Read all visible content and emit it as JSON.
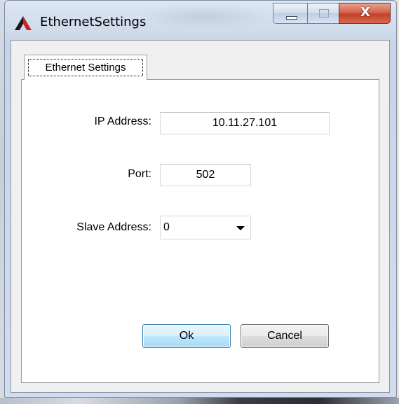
{
  "window": {
    "title": "EthernetSettings",
    "icon": "app-logo-icon",
    "buttons": {
      "minimize_icon": "minimize-icon",
      "maximize_icon": "maximize-icon",
      "close_icon": "close-icon",
      "close_glyph": "X"
    }
  },
  "tabs": [
    {
      "label": "Ethernet Settings",
      "selected": true
    }
  ],
  "form": {
    "ip_label": "IP Address:",
    "ip_value": "10.11.27.101",
    "port_label": "Port:",
    "port_value": "502",
    "slave_label": "Slave Address:",
    "slave_value": "0"
  },
  "actions": {
    "ok_label": "Ok",
    "cancel_label": "Cancel"
  },
  "colors": {
    "close_button": "#c2412b",
    "ok_button_border": "#3c7fb1"
  }
}
